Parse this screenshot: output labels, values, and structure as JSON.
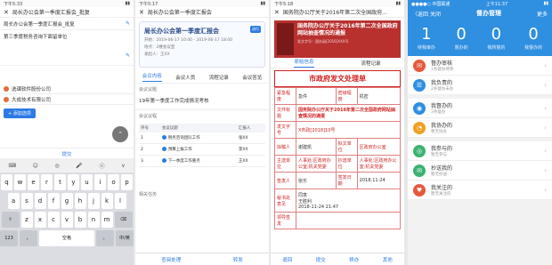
{
  "p1": {
    "time": "下午5:33",
    "nav_title": "局长办公会第一季度汇报会_批复",
    "input_title": "局长办公会第一季度汇报会_批复",
    "input2": "第三季度税务咨询下面留单位",
    "orgs": [
      "选课软件股份公司",
      "大成技术有限公司"
    ],
    "add_label": "+ 添加选项",
    "submit": "提交",
    "kb_tools": [
      "⌨",
      "☺",
      "◎",
      "🎤",
      "ⓔ",
      "∨"
    ],
    "kb_rows": [
      [
        "q",
        "w",
        "e",
        "r",
        "t",
        "y",
        "u",
        "i",
        "o",
        "p"
      ],
      [
        "a",
        "s",
        "d",
        "f",
        "g",
        "h",
        "j",
        "k",
        "l"
      ],
      [
        "⇧",
        "z",
        "x",
        "c",
        "v",
        "b",
        "n",
        "m",
        "⌫"
      ],
      [
        "符号",
        "123",
        "，",
        "空格",
        "。",
        "中/英",
        "换行"
      ]
    ]
  },
  "p2": {
    "time": "下午5:17",
    "nav_title": "局长办公会第一季度汇报会",
    "card_title": "局长办公会第一季度汇报会",
    "card_meta": [
      "开始：2019-06-17 10:00 - 2019-06-17 18:00",
      "地点：2楼会议室",
      "发起人：王XX"
    ],
    "card_tag": "进行",
    "tabs": [
      "会议内容",
      "会议人员",
      "流程记录",
      "会议答览"
    ],
    "sec1": "会议议题",
    "val1": "19年第一季度工作完成情况考核",
    "sec2": "会议议程",
    "table_head": [
      "序号",
      "会议议题",
      "汇报人"
    ],
    "rows": [
      [
        "1",
        "税务咨询团队工作",
        "张XX"
      ],
      [
        "2",
        "预算上报工作",
        "李XX"
      ],
      [
        "3",
        "下一季度工作重点",
        "王XX"
      ]
    ],
    "sec3": "相关任务",
    "foot": [
      "查阅处理",
      "转发"
    ]
  },
  "p3": {
    "time": "下午5:18",
    "nav_title": "国务院办公厅关于2016年第二次全国政府...",
    "tabs": [
      "原始信息",
      "流程记录"
    ],
    "banner_title": "国务院办公厅关于2016年第二次全国政府网站抽查情况的通报",
    "banner_meta": "发文字号：国办函[2016]XXX号",
    "form_title": "市政府发文处理单",
    "rows": [
      [
        "紧急程度",
        "急件",
        "密级程度",
        "机密"
      ],
      [
        "文件标题",
        "国务院办公厅关于2016年第二次全国政府网站抽查情况的通报",
        "",
        ""
      ],
      [
        "发文字号",
        "X市政[2018]10号",
        "",
        ""
      ],
      [
        "拟稿人",
        "谢建凯",
        "拟文单位",
        "区政府办公室"
      ],
      [
        "主送单位",
        "人事处;区政府办公室;机关党委",
        "抄送单位",
        "人事处;区政府办公室;机关党委"
      ],
      [
        "签发人",
        "张乐",
        "签发日期",
        "2018-11-24"
      ],
      [
        "秘书处意见",
        "同意\n王胜利\n2018-11-24 21:47",
        "",
        ""
      ],
      [
        "领导签发",
        "",
        "",
        ""
      ]
    ],
    "foot": [
      "退回",
      "提交",
      "移办",
      "其他"
    ]
  },
  "p4": {
    "time": "上午11:37",
    "carrier": "●●●●○ 中国联通",
    "back": "〈返回",
    "close": "关闭",
    "title": "督办管理",
    "more": "更多",
    "stats": [
      {
        "n": "1",
        "l": "待我审办"
      },
      {
        "n": "0",
        "l": "督办的"
      },
      {
        "n": "0",
        "l": "我所督的"
      },
      {
        "n": "0",
        "l": "我督办的"
      }
    ],
    "items": [
      {
        "a": "督办审核",
        "b": "1条督办待审",
        "c": "#e55a3c",
        "i": "✉"
      },
      {
        "a": "我负责的",
        "b": "2条督办未办",
        "c": "#2f8fe0",
        "i": "☰"
      },
      {
        "a": "我督办的",
        "b": "3条督办",
        "c": "#2f8fe0",
        "i": "◉"
      },
      {
        "a": "我协办的",
        "b": "暂无协办",
        "c": "#f0a020",
        "i": "◔"
      },
      {
        "a": "我参与的",
        "b": "暂无参与",
        "c": "#3cb371",
        "i": "◎"
      },
      {
        "a": "抄送我的",
        "b": "暂无抄送",
        "c": "#3cb371",
        "i": "✉"
      },
      {
        "a": "我关注的",
        "b": "暂无关注的",
        "c": "#e55a3c",
        "i": "♥"
      }
    ]
  }
}
